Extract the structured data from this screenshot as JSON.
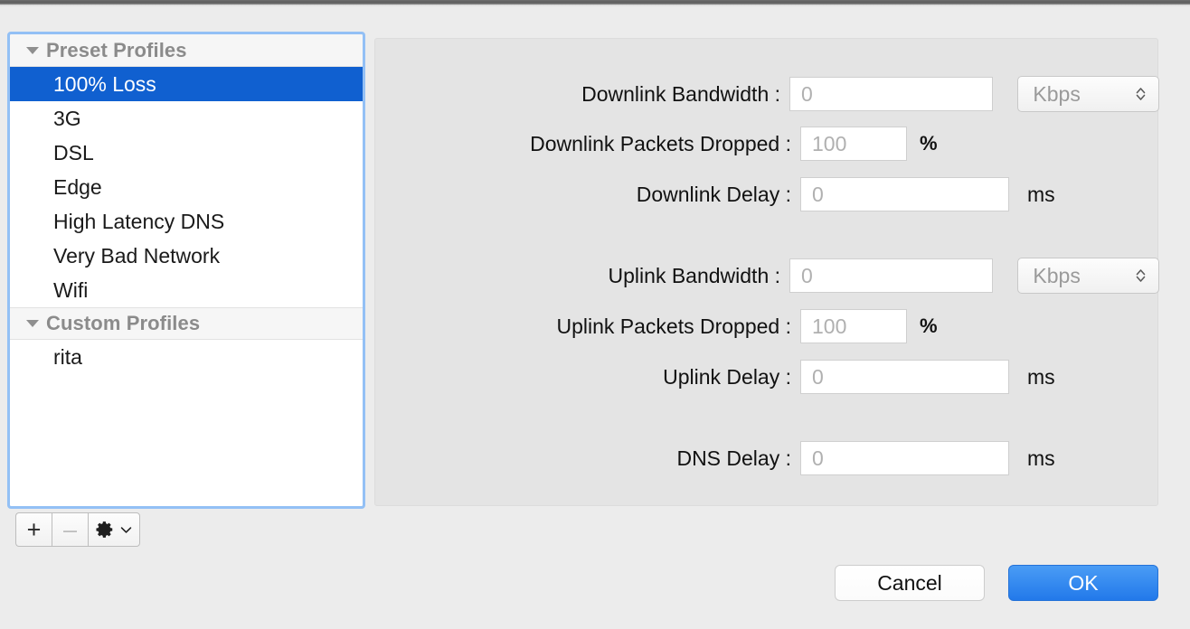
{
  "window": {
    "background_color": "#ececec",
    "accent_color": "#1060d0"
  },
  "profiles_list": {
    "groups": [
      {
        "header": "Preset Profiles",
        "disclosure_icon": "triangle-down-icon",
        "items": [
          {
            "label": "100% Loss",
            "selected": true
          },
          {
            "label": "3G",
            "selected": false
          },
          {
            "label": "DSL",
            "selected": false
          },
          {
            "label": "Edge",
            "selected": false
          },
          {
            "label": "High Latency DNS",
            "selected": false
          },
          {
            "label": "Very Bad Network",
            "selected": false
          },
          {
            "label": "Wifi",
            "selected": false
          }
        ]
      },
      {
        "header": "Custom Profiles",
        "disclosure_icon": "triangle-down-icon",
        "items": [
          {
            "label": "rita",
            "selected": false
          }
        ]
      }
    ]
  },
  "list_toolbar": {
    "add_label": "+",
    "remove_label": "–",
    "gear_icon": "gear-icon",
    "chevron_icon": "chevron-down-icon"
  },
  "settings": {
    "fields": [
      {
        "label": "Downlink Bandwidth :",
        "value": "0",
        "unit": "",
        "field_width": "wide",
        "popup": {
          "value": "Kbps"
        }
      },
      {
        "label": "Downlink Packets Dropped :",
        "value": "100",
        "unit": "%",
        "field_width": "narrow"
      },
      {
        "label": "Downlink Delay :",
        "value": "0",
        "unit": "ms",
        "field_width": "wide"
      },
      {
        "label": "Uplink Bandwidth :",
        "value": "0",
        "unit": "",
        "field_width": "wide",
        "popup": {
          "value": "Kbps"
        }
      },
      {
        "label": "Uplink Packets Dropped :",
        "value": "100",
        "unit": "%",
        "field_width": "narrow"
      },
      {
        "label": "Uplink Delay :",
        "value": "0",
        "unit": "ms",
        "field_width": "wide"
      },
      {
        "label": "DNS Delay :",
        "value": "0",
        "unit": "ms",
        "field_width": "wide"
      }
    ]
  },
  "footer": {
    "cancel_label": "Cancel",
    "ok_label": "OK"
  }
}
